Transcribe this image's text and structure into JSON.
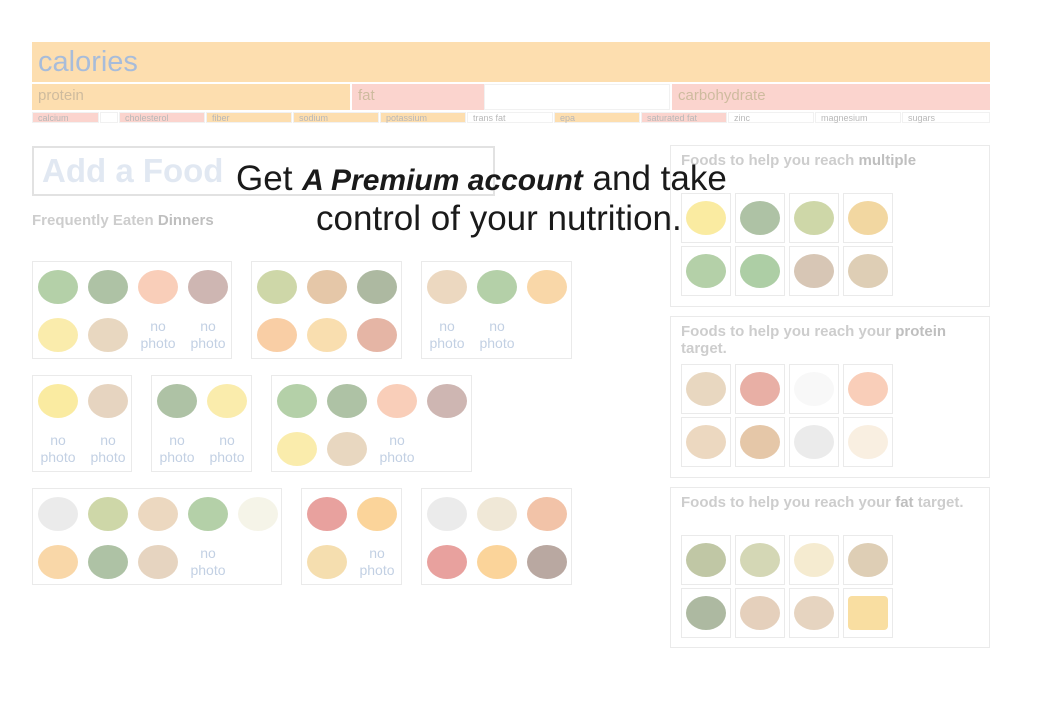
{
  "nutrients": {
    "calories": "calories",
    "row2": [
      "protein",
      "fat",
      "",
      "carbohydrate"
    ],
    "row3": [
      "calcium",
      "",
      "cholesterol",
      "fiber",
      "sodium",
      "potassium",
      "trans fat",
      "epa",
      "saturated fat",
      "zinc",
      "magnesium",
      "sugars"
    ]
  },
  "add_food": {
    "placeholder": "Add a Food"
  },
  "frequent": {
    "prefix": "Frequently Eaten ",
    "meal": "Dinners"
  },
  "no_photo": [
    "no",
    "photo"
  ],
  "promo": {
    "get": "Get",
    "premium": "A Premium account",
    "rest1": "and take",
    "line2": "control of your nutrition."
  },
  "sidebar": {
    "multiple": {
      "prefix": "Foods to help you reach ",
      "bold": "multiple",
      "suffix": ""
    },
    "protein": {
      "prefix": "Foods to help you reach your ",
      "bold": "protein",
      "suffix": " target."
    },
    "fat": {
      "prefix": "Foods to help you reach your ",
      "bold": "fat",
      "suffix": " target."
    }
  },
  "colors": {
    "calories": "#fbb040",
    "protein": "#fbb040",
    "fat": "#f59a8a",
    "label_blue": "#2e5fa8"
  }
}
